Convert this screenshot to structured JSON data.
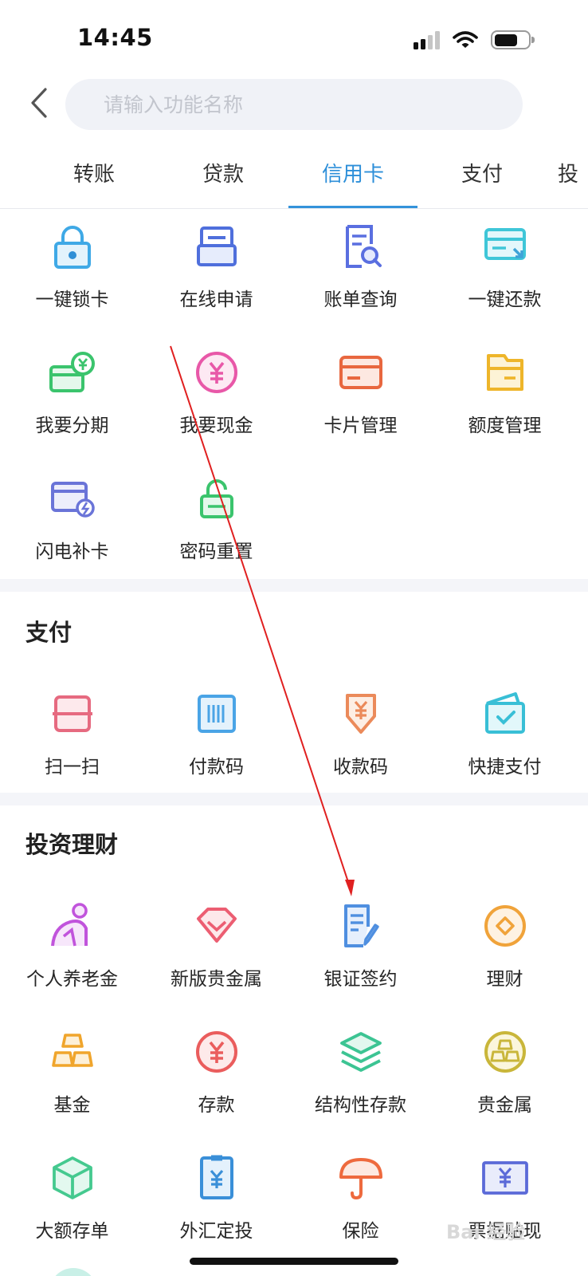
{
  "status_bar": {
    "time": "14:45"
  },
  "search": {
    "placeholder": "请输入功能名称"
  },
  "tabs": [
    {
      "label": "转账",
      "active": false
    },
    {
      "label": "贷款",
      "active": false
    },
    {
      "label": "信用卡",
      "active": true
    },
    {
      "label": "支付",
      "active": false
    },
    {
      "label": "投",
      "active": false
    }
  ],
  "credit_card": {
    "items": [
      {
        "label": "一键锁卡",
        "icon": "lock-icon"
      },
      {
        "label": "在线申请",
        "icon": "apply-icon"
      },
      {
        "label": "账单查询",
        "icon": "bill-search-icon"
      },
      {
        "label": "一键还款",
        "icon": "repay-icon"
      },
      {
        "label": "我要分期",
        "icon": "installment-icon"
      },
      {
        "label": "我要现金",
        "icon": "cash-yuan-icon"
      },
      {
        "label": "卡片管理",
        "icon": "card-manage-icon"
      },
      {
        "label": "额度管理",
        "icon": "quota-folder-icon"
      },
      {
        "label": "闪电补卡",
        "icon": "flash-card-icon"
      },
      {
        "label": "密码重置",
        "icon": "unlock-icon"
      }
    ]
  },
  "payment": {
    "title": "支付",
    "items": [
      {
        "label": "扫一扫",
        "icon": "scan-icon"
      },
      {
        "label": "付款码",
        "icon": "barcode-icon"
      },
      {
        "label": "收款码",
        "icon": "receive-yuan-icon"
      },
      {
        "label": "快捷支付",
        "icon": "quick-pay-icon"
      }
    ]
  },
  "investment": {
    "title": "投资理财",
    "items": [
      {
        "label": "个人养老金",
        "icon": "pension-person-icon"
      },
      {
        "label": "新版贵金属",
        "icon": "diamond-icon"
      },
      {
        "label": "银证签约",
        "icon": "document-sign-icon"
      },
      {
        "label": "理财",
        "icon": "coin-icon"
      },
      {
        "label": "基金",
        "icon": "gold-bars-icon"
      },
      {
        "label": "存款",
        "icon": "deposit-yuan-icon"
      },
      {
        "label": "结构性存款",
        "icon": "layers-icon"
      },
      {
        "label": "贵金属",
        "icon": "gold-circle-icon"
      },
      {
        "label": "大额存单",
        "icon": "cube-icon"
      },
      {
        "label": "外汇定投",
        "icon": "forex-doc-icon"
      },
      {
        "label": "保险",
        "icon": "umbrella-icon"
      },
      {
        "label": "票据贴现",
        "icon": "note-yuan-icon"
      }
    ]
  },
  "watermark": "Bai 经验",
  "colors": {
    "accent": "#3493db",
    "background": "#ffffff",
    "section_band": "#f4f5f9",
    "annotation_arrow": "#e02020"
  }
}
